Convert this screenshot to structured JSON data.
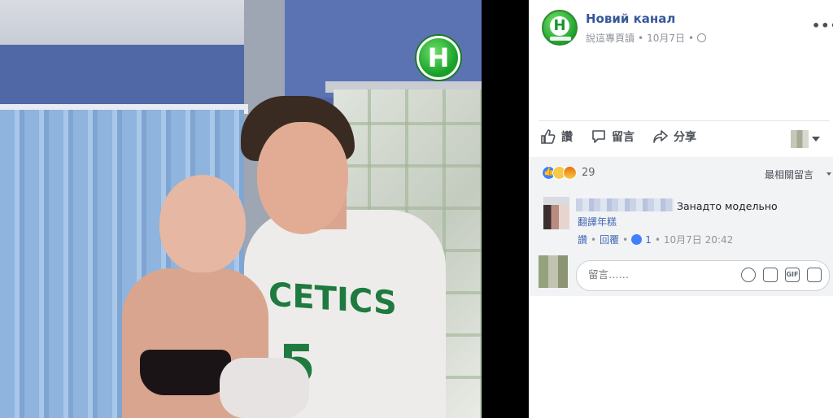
{
  "post": {
    "channel_logo_letter": "Н",
    "page_name": "Новий канал",
    "meta_page": "說這專頁讀",
    "meta_date": "10月7日",
    "dots": "•",
    "more": "•••"
  },
  "actions": {
    "like_label": "讚",
    "comment_label": "留言",
    "share_label": "分享"
  },
  "photo": {
    "shirt_text": "CETICS",
    "shirt_number": "5"
  },
  "reactions": {
    "count": "29",
    "sort_label": "最相關留言"
  },
  "comment": {
    "text": "Занадто модельно",
    "translate_label": "翻譯年糕",
    "like_label": "讚",
    "reply_label": "回覆",
    "like_count": "1",
    "time": "10月7日 20:42"
  },
  "composer": {
    "placeholder": "留言……",
    "gif_label": "GIF"
  },
  "colors": {
    "accent": "#365899",
    "link": "#4267b2",
    "brand_green": "#1ea32d"
  }
}
